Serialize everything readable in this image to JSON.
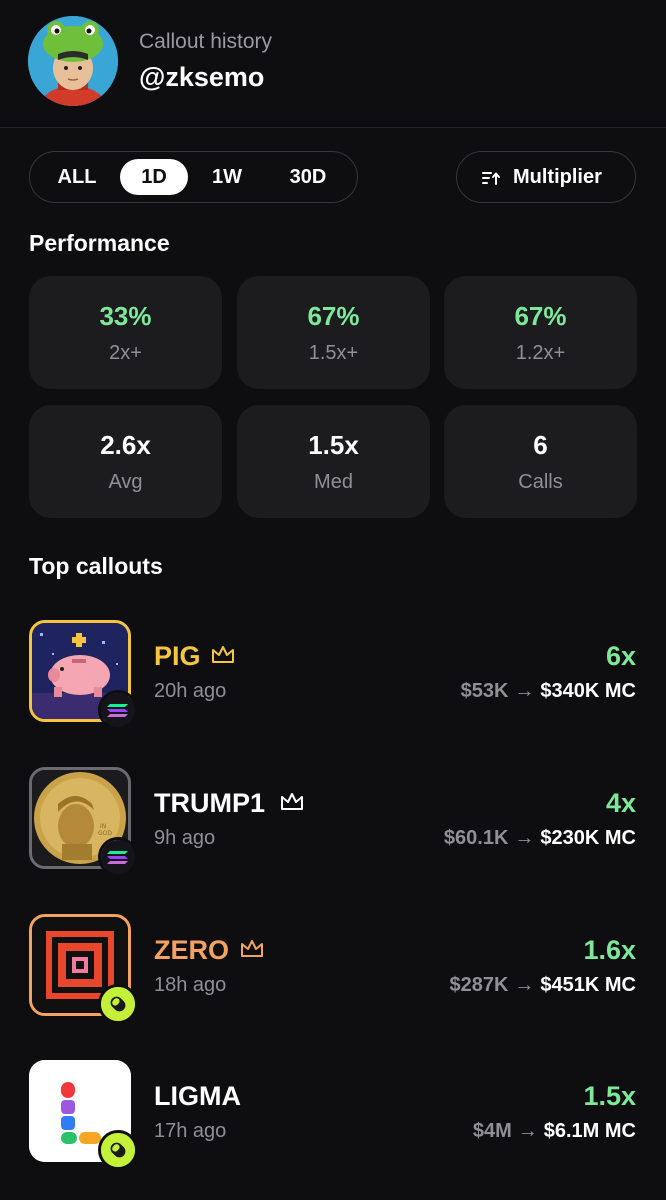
{
  "header": {
    "subtitle": "Callout history",
    "username": "@zksemo"
  },
  "tabs": [
    {
      "label": "ALL",
      "active": false
    },
    {
      "label": "1D",
      "active": true
    },
    {
      "label": "1W",
      "active": false
    },
    {
      "label": "30D",
      "active": false
    }
  ],
  "sort_button": {
    "label": "Multiplier",
    "icon": "sort-ascending-icon"
  },
  "performance": {
    "title": "Performance",
    "cards": [
      {
        "value": "33%",
        "label": "2x+"
      },
      {
        "value": "67%",
        "label": "1.5x+"
      },
      {
        "value": "67%",
        "label": "1.2x+"
      },
      {
        "value": "2.6x",
        "label": "Avg"
      },
      {
        "value": "1.5x",
        "label": "Med"
      },
      {
        "value": "6",
        "label": "Calls"
      }
    ]
  },
  "top_callouts": {
    "title": "Top callouts",
    "items": [
      {
        "name": "PIG",
        "crown": true,
        "time": "20h ago",
        "multiplier": "6x",
        "from": "$53K",
        "arrow": "→",
        "to": "$340K MC",
        "name_color": "#f5c53d",
        "chain": "solana-icon"
      },
      {
        "name": "TRUMP1",
        "crown": true,
        "time": "9h ago",
        "multiplier": "4x",
        "from": "$60.1K",
        "arrow": "→",
        "to": "$230K MC",
        "name_color": "#ffffff",
        "chain": "solana-icon"
      },
      {
        "name": "ZERO",
        "crown": true,
        "time": "18h ago",
        "multiplier": "1.6x",
        "from": "$287K",
        "arrow": "→",
        "to": "$451K MC",
        "name_color": "#f4a261",
        "chain": "pumpfun-pill-icon"
      },
      {
        "name": "LIGMA",
        "crown": false,
        "time": "17h ago",
        "multiplier": "1.5x",
        "from": "$4M",
        "arrow": "→",
        "to": "$6.1M MC",
        "name_color": "#ffffff",
        "chain": "pumpfun-pill-icon"
      }
    ]
  },
  "colors": {
    "positive": "#7ee89a",
    "background": "#0e0e10",
    "card": "#1c1c1f",
    "gold": "#f5c53d"
  }
}
